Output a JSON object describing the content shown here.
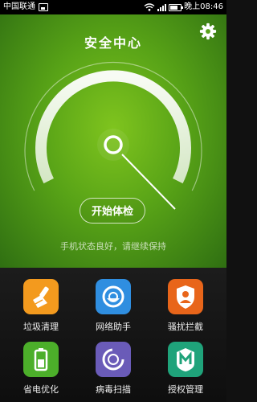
{
  "status_bar": {
    "carrier": "中国联通",
    "time": "晚上08:46"
  },
  "header": {
    "title": "安全中心"
  },
  "gauge": {
    "scan_button": "开始体检",
    "status_message": "手机状态良好，请继续保持"
  },
  "tools": [
    {
      "label": "垃圾清理",
      "icon": "broom-icon",
      "color": "#f39a1e"
    },
    {
      "label": "网络助手",
      "icon": "network-icon",
      "color": "#2f8ee0"
    },
    {
      "label": "骚扰拦截",
      "icon": "shield-user-icon",
      "color": "#e8651a"
    },
    {
      "label": "省电优化",
      "icon": "battery-icon",
      "color": "#4caf2a"
    },
    {
      "label": "病毒扫描",
      "icon": "virus-scan-icon",
      "color": "#6a5bb8"
    },
    {
      "label": "授权管理",
      "icon": "authorization-icon",
      "color": "#1fa37a"
    }
  ]
}
